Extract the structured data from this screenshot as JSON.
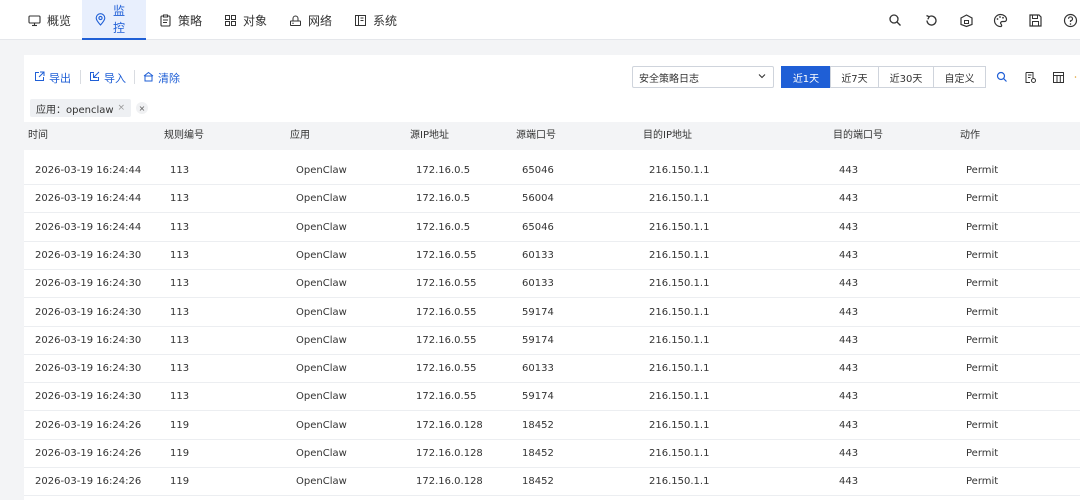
{
  "nav": {
    "tabs": [
      {
        "label": "概览",
        "icon": "monitor-icon"
      },
      {
        "label": "监控",
        "icon": "location-pin-icon",
        "active": true
      },
      {
        "label": "策略",
        "icon": "clipboard-icon"
      },
      {
        "label": "对象",
        "icon": "grid-icon"
      },
      {
        "label": "网络",
        "icon": "network-icon"
      },
      {
        "label": "系统",
        "icon": "system-icon"
      }
    ],
    "right_icons": [
      "search-icon",
      "refresh-icon",
      "package-icon",
      "palette-icon",
      "save-icon",
      "help-icon"
    ]
  },
  "toolbar": {
    "export_label": "导出",
    "import_label": "导入",
    "clear_label": "清除",
    "log_type_selected": "安全策略日志",
    "ranges": [
      "近1天",
      "近7天",
      "近30天",
      "自定义"
    ],
    "active_range": "近1天",
    "accent_color": "#1f5fd6"
  },
  "filter": {
    "tag_label": "应用：openclaw"
  },
  "table": {
    "columns": [
      "时间",
      "规则编号",
      "应用",
      "源IP地址",
      "源端口号",
      "目的IP地址",
      "目的端口号",
      "动作"
    ],
    "rows": [
      [
        "2026-03-19 16:24:44",
        "113",
        "OpenClaw",
        "172.16.0.5",
        "65046",
        "216.150.1.1",
        "443",
        "Permit"
      ],
      [
        "2026-03-19 16:24:44",
        "113",
        "OpenClaw",
        "172.16.0.5",
        "56004",
        "216.150.1.1",
        "443",
        "Permit"
      ],
      [
        "2026-03-19 16:24:44",
        "113",
        "OpenClaw",
        "172.16.0.5",
        "65046",
        "216.150.1.1",
        "443",
        "Permit"
      ],
      [
        "2026-03-19 16:24:30",
        "113",
        "OpenClaw",
        "172.16.0.55",
        "60133",
        "216.150.1.1",
        "443",
        "Permit"
      ],
      [
        "2026-03-19 16:24:30",
        "113",
        "OpenClaw",
        "172.16.0.55",
        "60133",
        "216.150.1.1",
        "443",
        "Permit"
      ],
      [
        "2026-03-19 16:24:30",
        "113",
        "OpenClaw",
        "172.16.0.55",
        "59174",
        "216.150.1.1",
        "443",
        "Permit"
      ],
      [
        "2026-03-19 16:24:30",
        "113",
        "OpenClaw",
        "172.16.0.55",
        "59174",
        "216.150.1.1",
        "443",
        "Permit"
      ],
      [
        "2026-03-19 16:24:30",
        "113",
        "OpenClaw",
        "172.16.0.55",
        "60133",
        "216.150.1.1",
        "443",
        "Permit"
      ],
      [
        "2026-03-19 16:24:30",
        "113",
        "OpenClaw",
        "172.16.0.55",
        "59174",
        "216.150.1.1",
        "443",
        "Permit"
      ],
      [
        "2026-03-19 16:24:26",
        "119",
        "OpenClaw",
        "172.16.0.128",
        "18452",
        "216.150.1.1",
        "443",
        "Permit"
      ],
      [
        "2026-03-19 16:24:26",
        "119",
        "OpenClaw",
        "172.16.0.128",
        "18452",
        "216.150.1.1",
        "443",
        "Permit"
      ],
      [
        "2026-03-19 16:24:26",
        "119",
        "OpenClaw",
        "172.16.0.128",
        "18452",
        "216.150.1.1",
        "443",
        "Permit"
      ]
    ]
  }
}
